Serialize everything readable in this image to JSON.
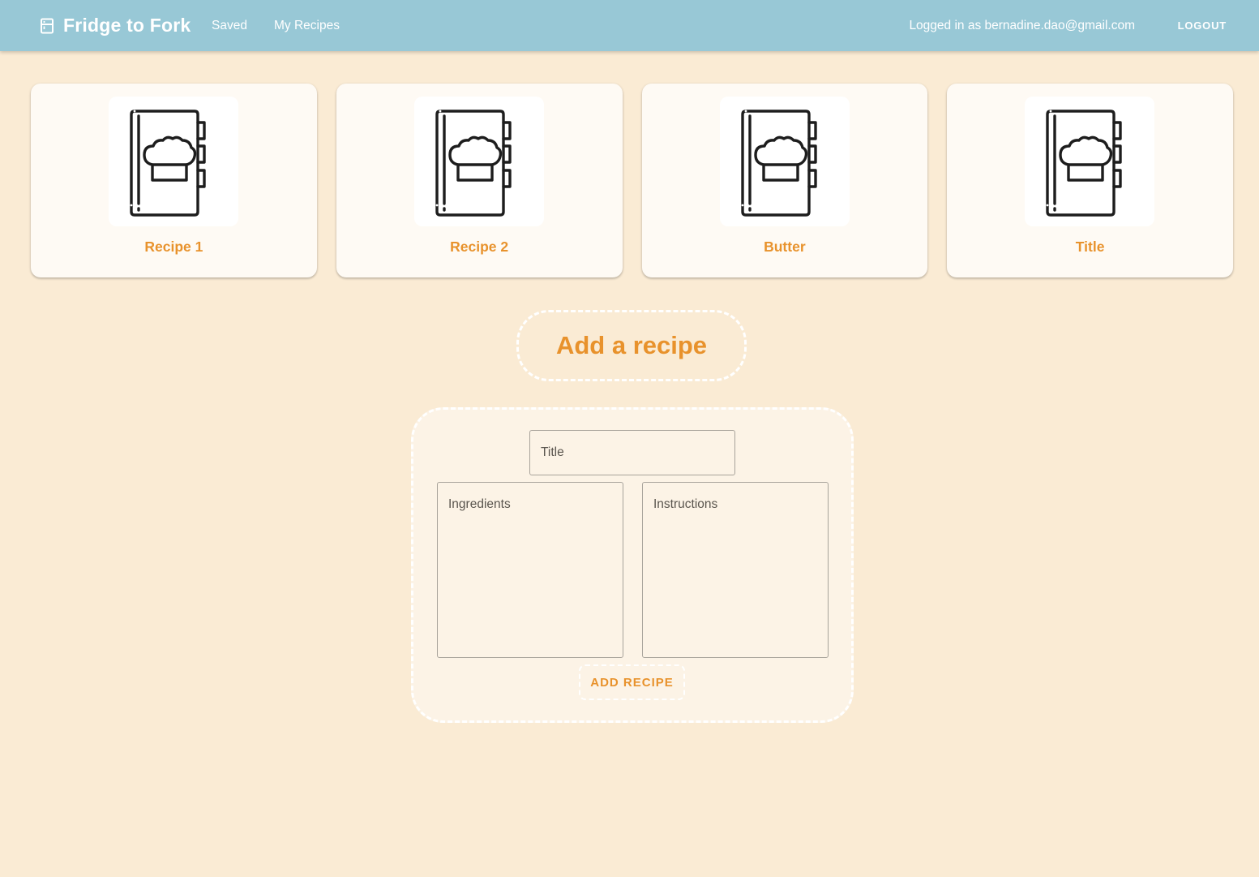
{
  "navbar": {
    "brand_icon": "fridge-icon",
    "brand_title": "Fridge to Fork",
    "links": [
      "Saved",
      "My Recipes"
    ],
    "user_status": "Logged in as bernadine.dao@gmail.com",
    "logout_label": "LOGOUT"
  },
  "colors": {
    "navbar": "#98c8d6",
    "page_background": "#faebd4",
    "accent": "#e8922c",
    "card_background": "#fefaf4"
  },
  "recipes": [
    {
      "title": "Recipe 1",
      "icon": "recipe-book-chef-hat-icon"
    },
    {
      "title": "Recipe 2",
      "icon": "recipe-book-chef-hat-icon"
    },
    {
      "title": "Butter",
      "icon": "recipe-book-chef-hat-icon"
    },
    {
      "title": "Title",
      "icon": "recipe-book-chef-hat-icon"
    }
  ],
  "add_recipe": {
    "heading": "Add a recipe",
    "title_placeholder": "Title",
    "ingredients_placeholder": "Ingredients",
    "instructions_placeholder": "Instructions",
    "submit_label": "ADD RECIPE"
  }
}
